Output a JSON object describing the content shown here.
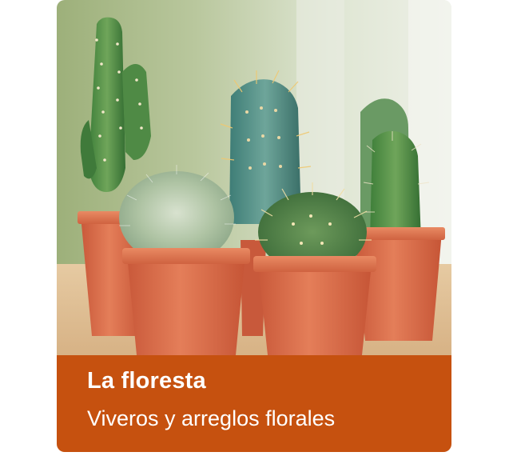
{
  "card": {
    "title": "La floresta",
    "subtitle": "Viveros y arreglos florales",
    "image_subject": "cactus-in-pots",
    "colors": {
      "banner": "#c6510f",
      "banner_text": "#ffffff",
      "pot": "#dd7350"
    }
  }
}
